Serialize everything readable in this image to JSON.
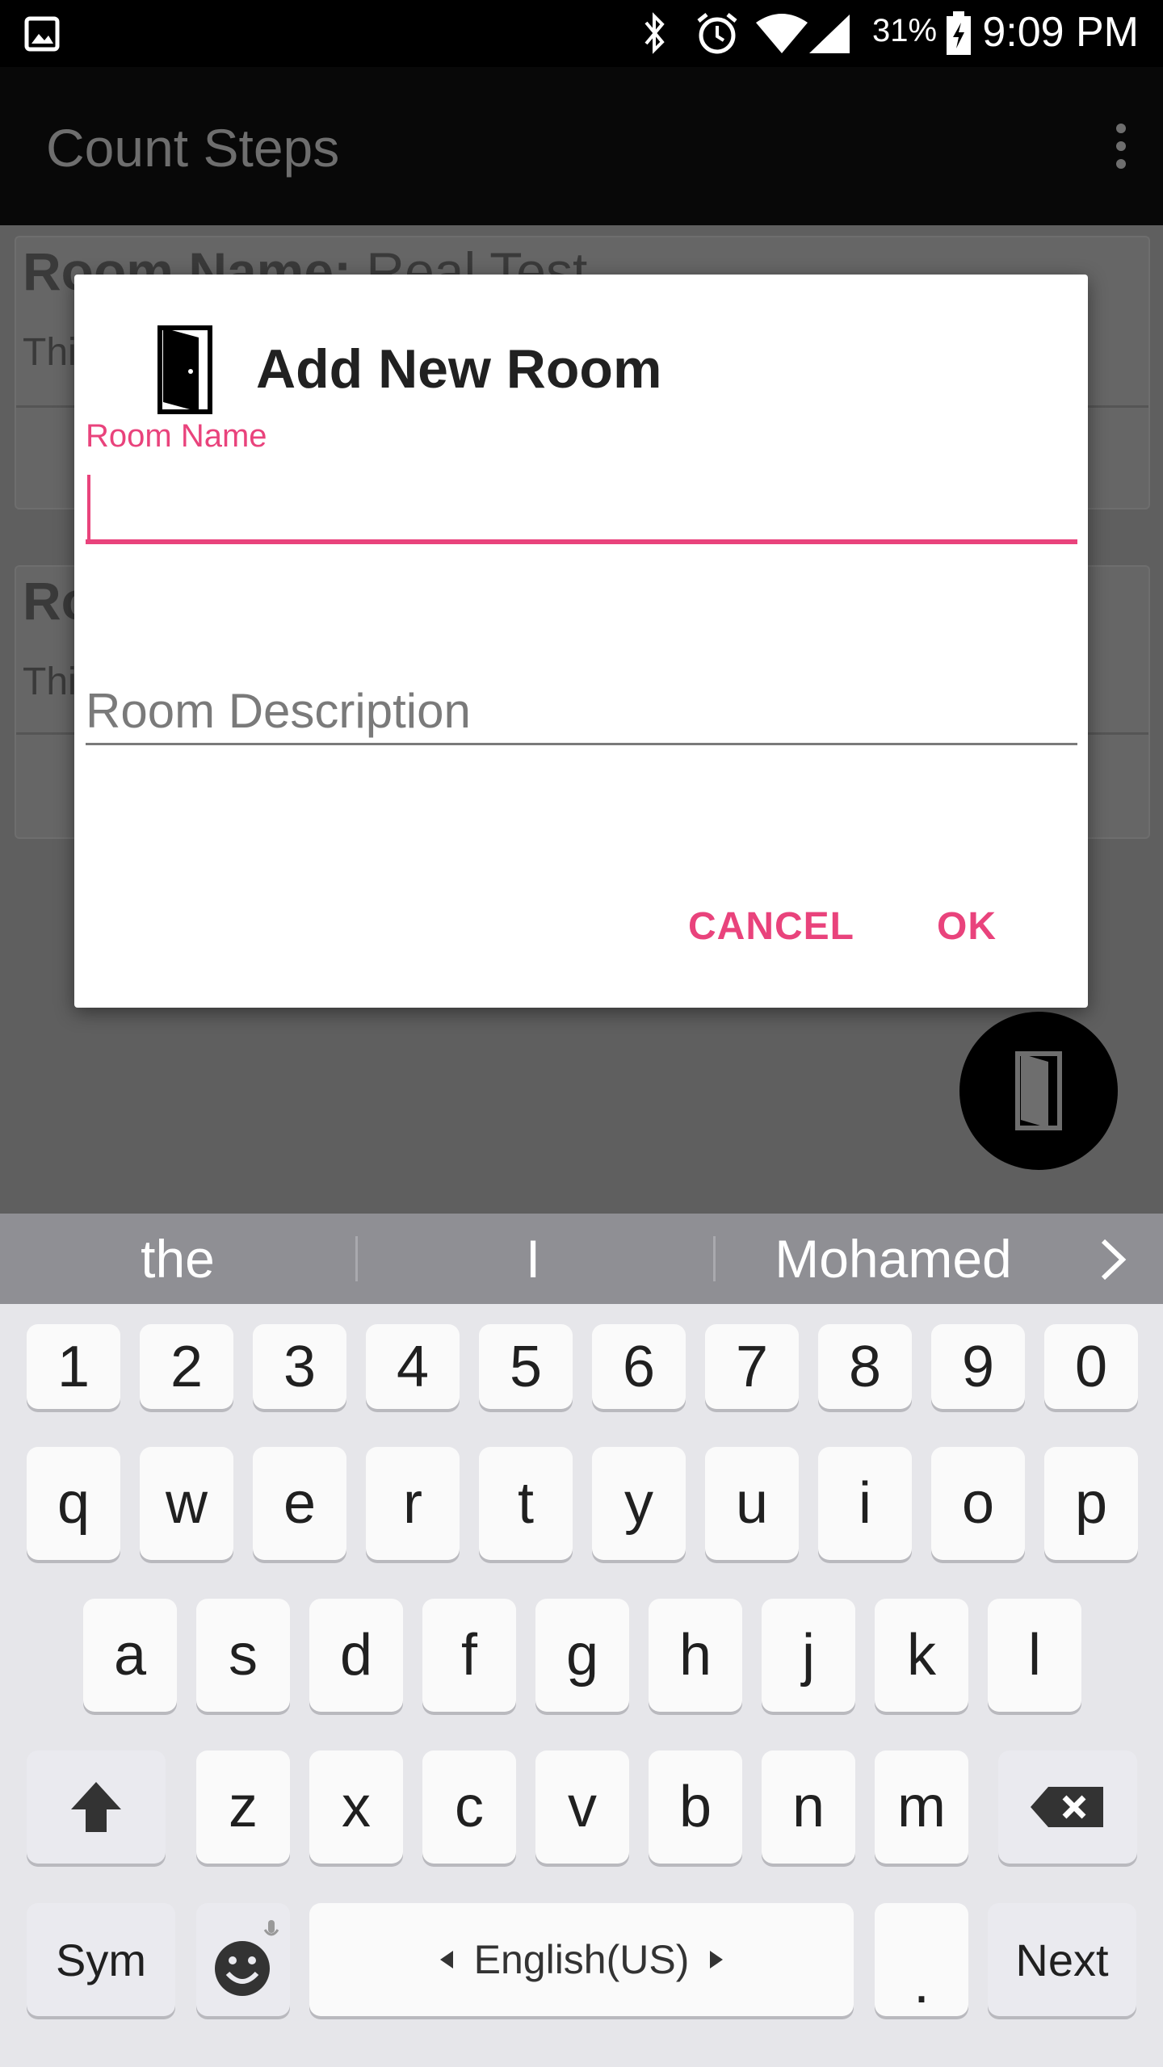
{
  "status_bar": {
    "battery": "31%",
    "time": "9:09 PM"
  },
  "app_bar": {
    "title": "Count Steps"
  },
  "background_cards": [
    {
      "name_label": "Room Name:",
      "name_value": "Real Test",
      "desc": "Thi"
    },
    {
      "name_label": "Ro",
      "name_value": "",
      "desc": "Thi"
    }
  ],
  "dialog": {
    "title": "Add New Room",
    "room_name_label": "Room Name",
    "room_name_value": "",
    "room_description_hint": "Room Description",
    "cancel_label": "CANCEL",
    "ok_label": "OK"
  },
  "keyboard": {
    "suggestions": [
      "the",
      "I",
      "Mohamed"
    ],
    "row_numbers": [
      "1",
      "2",
      "3",
      "4",
      "5",
      "6",
      "7",
      "8",
      "9",
      "0"
    ],
    "row1": [
      "q",
      "w",
      "e",
      "r",
      "t",
      "y",
      "u",
      "i",
      "o",
      "p"
    ],
    "row2": [
      "a",
      "s",
      "d",
      "f",
      "g",
      "h",
      "j",
      "k",
      "l"
    ],
    "row3": [
      "z",
      "x",
      "c",
      "v",
      "b",
      "n",
      "m"
    ],
    "sym_label": "Sym",
    "space_label": "English(US)",
    "period_label": ".",
    "next_label": "Next"
  },
  "colors": {
    "accent": "#e9437c"
  }
}
